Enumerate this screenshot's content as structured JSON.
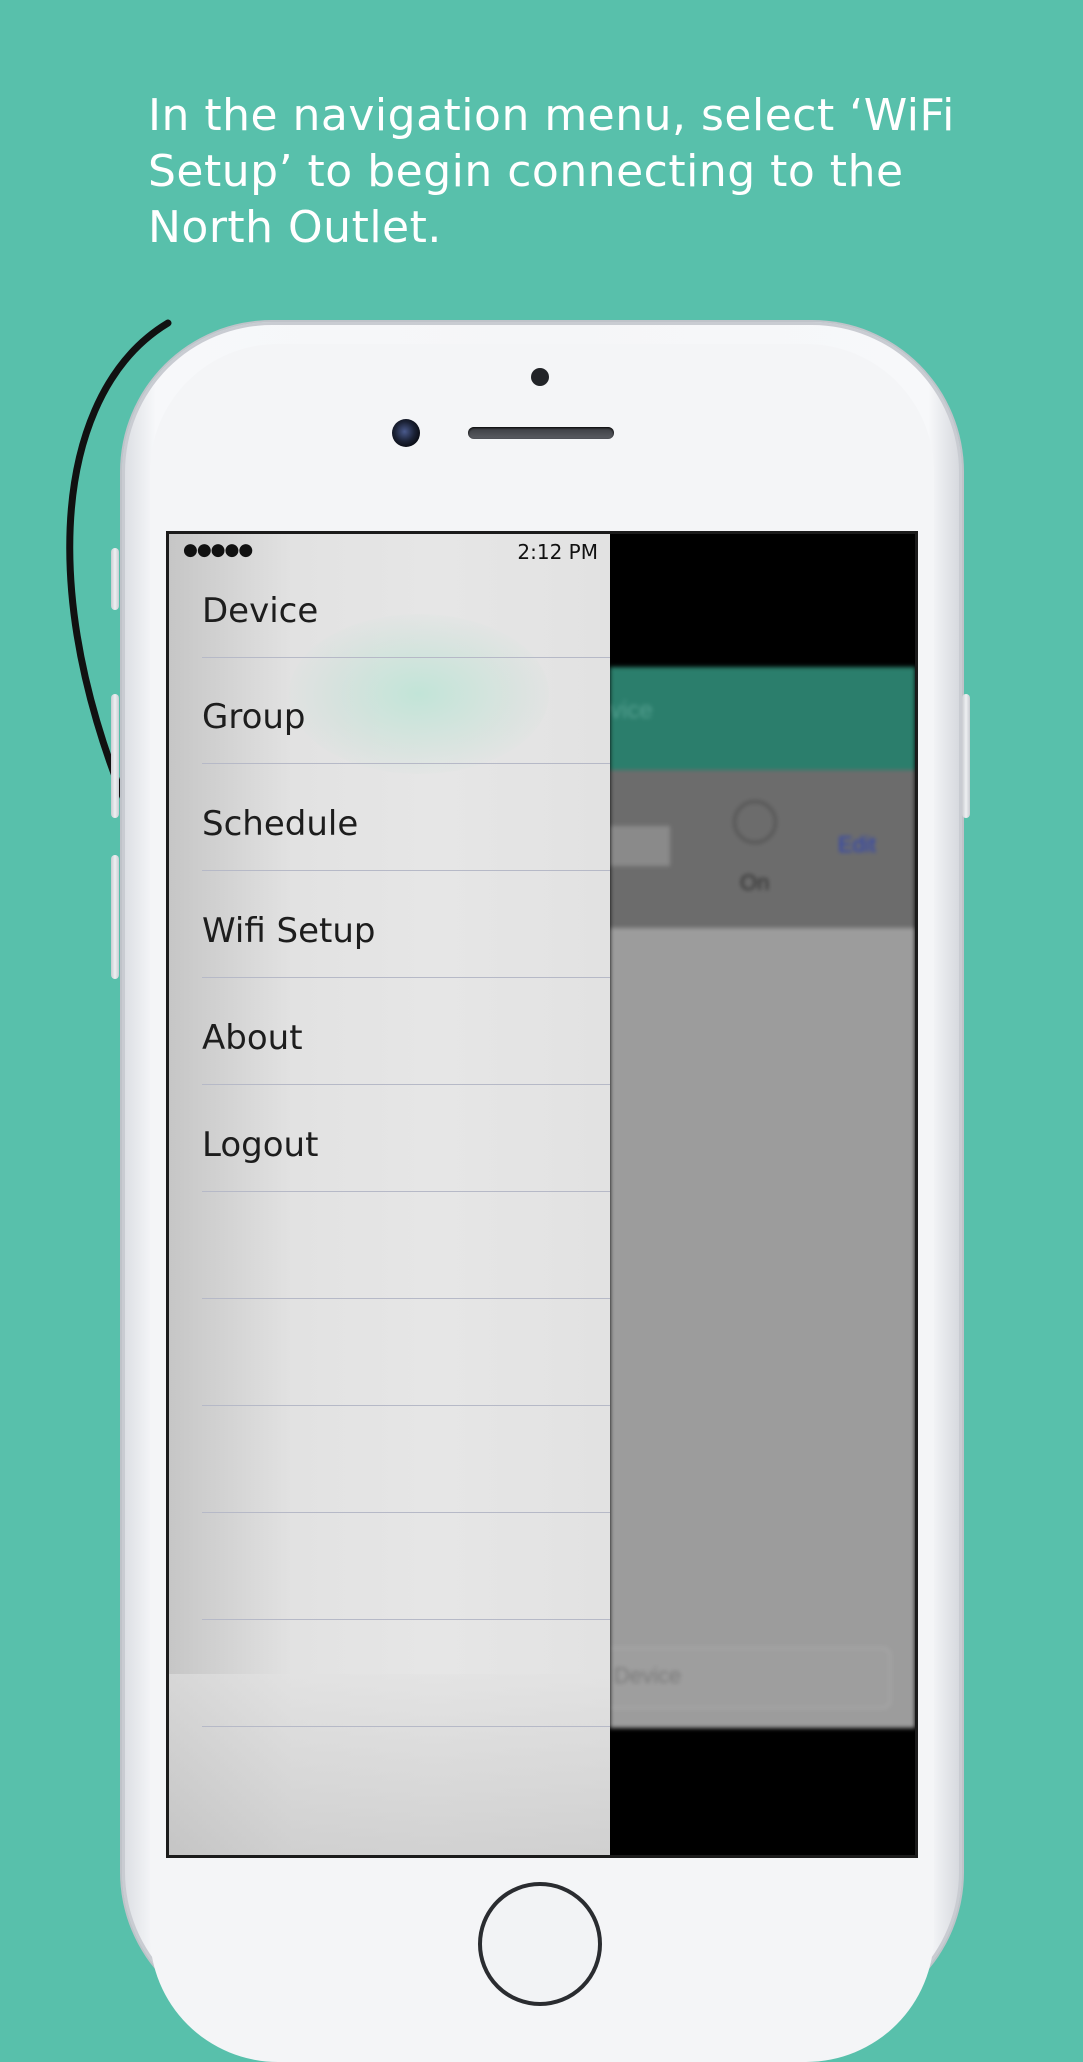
{
  "instruction": {
    "text": "In the navigation menu, select ‘WiFi Setup’ to begin connecting to the North Outlet."
  },
  "status_bar": {
    "signal": "●●●●●",
    "time": "2:12 PM"
  },
  "menu": {
    "items": [
      {
        "label": "Device"
      },
      {
        "label": "Group"
      },
      {
        "label": "Schedule"
      },
      {
        "label": "Wifi Setup"
      },
      {
        "label": "About"
      },
      {
        "label": "Logout"
      }
    ]
  },
  "background_app": {
    "title": "vice",
    "toggle_label": "On",
    "edit_label": "Edit",
    "add_field_label": "Device"
  },
  "colors": {
    "page_background": "#58c0ab",
    "app_bar": "#2b7e6c",
    "arrow": "#111111"
  }
}
